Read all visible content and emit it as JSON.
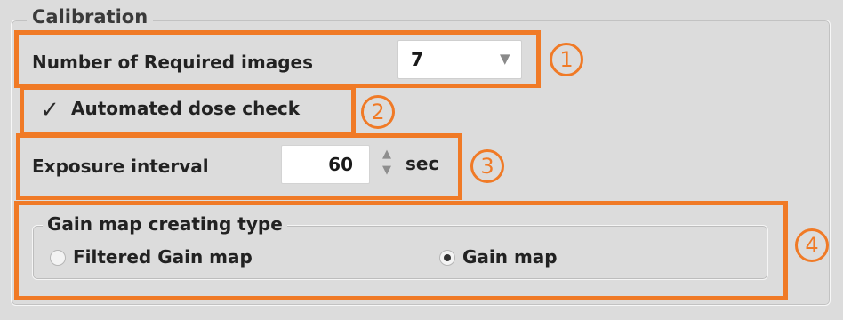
{
  "group": {
    "title": "Calibration"
  },
  "required_images": {
    "label": "Number of Required images",
    "value": "7"
  },
  "dose_check": {
    "label": "Automated dose check",
    "checked": true
  },
  "exposure": {
    "label": "Exposure interval",
    "value": "60",
    "unit": "sec"
  },
  "gain_map": {
    "title": "Gain map creating type",
    "options": [
      {
        "label": "Filtered Gain map",
        "selected": false
      },
      {
        "label": "Gain map",
        "selected": true
      }
    ]
  },
  "annotations": {
    "markers": [
      "1",
      "2",
      "3",
      "4"
    ],
    "color": "#f07a26"
  },
  "icons": {
    "dropdown": "chevron-down-icon",
    "check": "checkmark-icon",
    "stepper_up": "arrow-up-icon",
    "stepper_down": "arrow-down-icon"
  }
}
